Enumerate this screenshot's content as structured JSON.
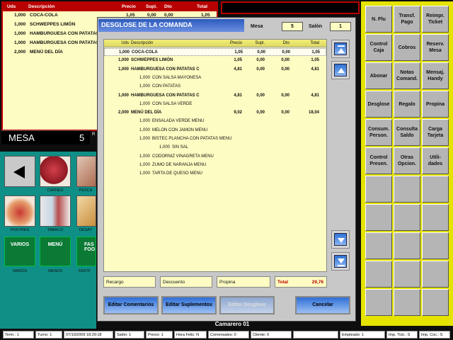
{
  "background_order": {
    "headers": {
      "uds": "Uds",
      "desc": "Descripción",
      "precio": "Precio",
      "supl": "Supl.",
      "dto": "Dto",
      "total": "Total"
    },
    "rows": [
      {
        "uds": "1,000",
        "desc": "COCA-COLA",
        "precio": "1,05",
        "supl": "0,00",
        "dto": "0,00",
        "total": "1,05"
      },
      {
        "uds": "1,000",
        "desc": "SCHWEPPES LIMÓN"
      },
      {
        "uds": "1,000",
        "desc": "HAMBURGUESA CON PATATAS"
      },
      {
        "uds": "1,000",
        "desc": "HAMBURGUESA CON PATATAS"
      },
      {
        "uds": "2,000",
        "desc": "MENÚ DEL DÍA"
      }
    ],
    "mesa_label": "MESA",
    "mesa_value": "5",
    "mesa_extra": "R"
  },
  "categories": {
    "back_icon": "left-arrow-icon",
    "items": [
      {
        "label": "CARNES",
        "icon": "meat-icon"
      },
      {
        "label": "PESCA",
        "icon": "fish-icon"
      },
      {
        "label": "POSTRES",
        "icon": "cake-icon"
      },
      {
        "label": "TABACO",
        "icon": "tobacco-icon"
      },
      {
        "label": "DESAY",
        "icon": "breakfast-icon"
      }
    ],
    "buttons": [
      {
        "label": "VARIOS",
        "sublabel": "VARIOS"
      },
      {
        "label": "MENÚ",
        "sublabel": "MENÚS"
      },
      {
        "label": "FAS FOO",
        "sublabel": "FASTF"
      }
    ]
  },
  "function_panel": {
    "buttons": [
      "N. Plu",
      "Transf. Pago",
      "Reimpr. Ticket",
      "Control Caja",
      "Cobros",
      "Reserv. Mesa",
      "Abonar",
      "Notas Comand.",
      "Mensaj. Handy",
      "Desglose",
      "Regalo",
      "Propina",
      "Consum. Person.",
      "Consulta Saldo",
      "Carga Tarjeta",
      "Control Presen.",
      "Otras Opcion.",
      "Utili- dades"
    ]
  },
  "modal": {
    "title": "DESGLOSE DE LA COMANDA",
    "mesa_label": "Mesa",
    "mesa_value": "5",
    "salon_label": "Salón",
    "salon_value": "1",
    "headers": {
      "uds": "Uds",
      "desc": "Descripción",
      "precio": "Precio",
      "supl": "Supl.",
      "dto": "Dto",
      "total": "Total"
    },
    "lines": [
      {
        "uds": "1,000",
        "desc": "COCA-COLA",
        "precio": "1,05",
        "supl": "0,00",
        "dto": "0,00",
        "total": "1,05",
        "main": true,
        "selected": true
      },
      {
        "uds": "1,000",
        "desc": "SCHWEPPES LIMÓN",
        "precio": "1,05",
        "supl": "0,00",
        "dto": "0,00",
        "total": "1,05",
        "main": true
      },
      {
        "uds": "1,000",
        "desc": "HAMBURGUESA CON PATATAS C",
        "precio": "4,81",
        "supl": "0,00",
        "dto": "0,00",
        "total": "4,81",
        "main": true
      },
      {
        "uds": "1,000",
        "desc": "CON SALSA MAYONESA",
        "level": 1
      },
      {
        "uds": "1,000",
        "desc": "CON PATATAS",
        "level": 1
      },
      {
        "uds": "1,000",
        "desc": "HAMBURGUESA CON PATATAS C",
        "precio": "4,81",
        "supl": "0,00",
        "dto": "0,00",
        "total": "4,81",
        "main": true
      },
      {
        "uds": "1,000",
        "desc": "CON SALSA VERDE",
        "level": 1
      },
      {
        "uds": "2,000",
        "desc": "MENÚ DEL DÍA",
        "precio": "9,02",
        "supl": "0,00",
        "dto": "0,00",
        "total": "18,04",
        "main": true
      },
      {
        "uds": "1,000",
        "desc": "ENSALADA VERDE MENU",
        "level": 1
      },
      {
        "uds": "1,000",
        "desc": "MELON CON JAMON MENU",
        "level": 1
      },
      {
        "uds": "1,000",
        "desc": "BISTEC PLANCHA CON PATATAS MENU",
        "level": 1
      },
      {
        "uds": "1,000",
        "desc": "SIN SAL",
        "level": 2
      },
      {
        "uds": "1,000",
        "desc": "CODORNIZ VINAGRETA MENU",
        "level": 1
      },
      {
        "uds": "1,000",
        "desc": "ZUMO DE NARANJA MENU",
        "level": 1
      },
      {
        "uds": "1,000",
        "desc": "TARTA DE QUESO MENU",
        "level": 1
      }
    ],
    "recargo_label": "Recargo",
    "descuento_label": "Descuento",
    "propina_label": "Propina",
    "total_label": "Total",
    "total_value": "29,76",
    "buttons": {
      "editar_comentarios": "Editar Comentarios",
      "editar_suplementos": "Editar Suplementos",
      "editar_desglose": "Editar Desglose",
      "cancelar": "Cancelar"
    }
  },
  "camarero": "Camarero 01",
  "status_bar": [
    "Term.: 1",
    "Turno: 1",
    "07/10/2009 18:29:18",
    "Salón: 1",
    "Precio: 1",
    "Hora Feliz: N",
    "Comensales: 0",
    "Cliente: 0",
    "",
    "Empleado: 1",
    "Imp. Tick.: S",
    "Imp. Coc.: S"
  ],
  "colors": {
    "accent": "#2c5bbd",
    "panel_yellow": "#e5e300",
    "grid_bg": "#fdfcc2",
    "order_border": "#b80000",
    "category_bg": "#0f8f86"
  }
}
